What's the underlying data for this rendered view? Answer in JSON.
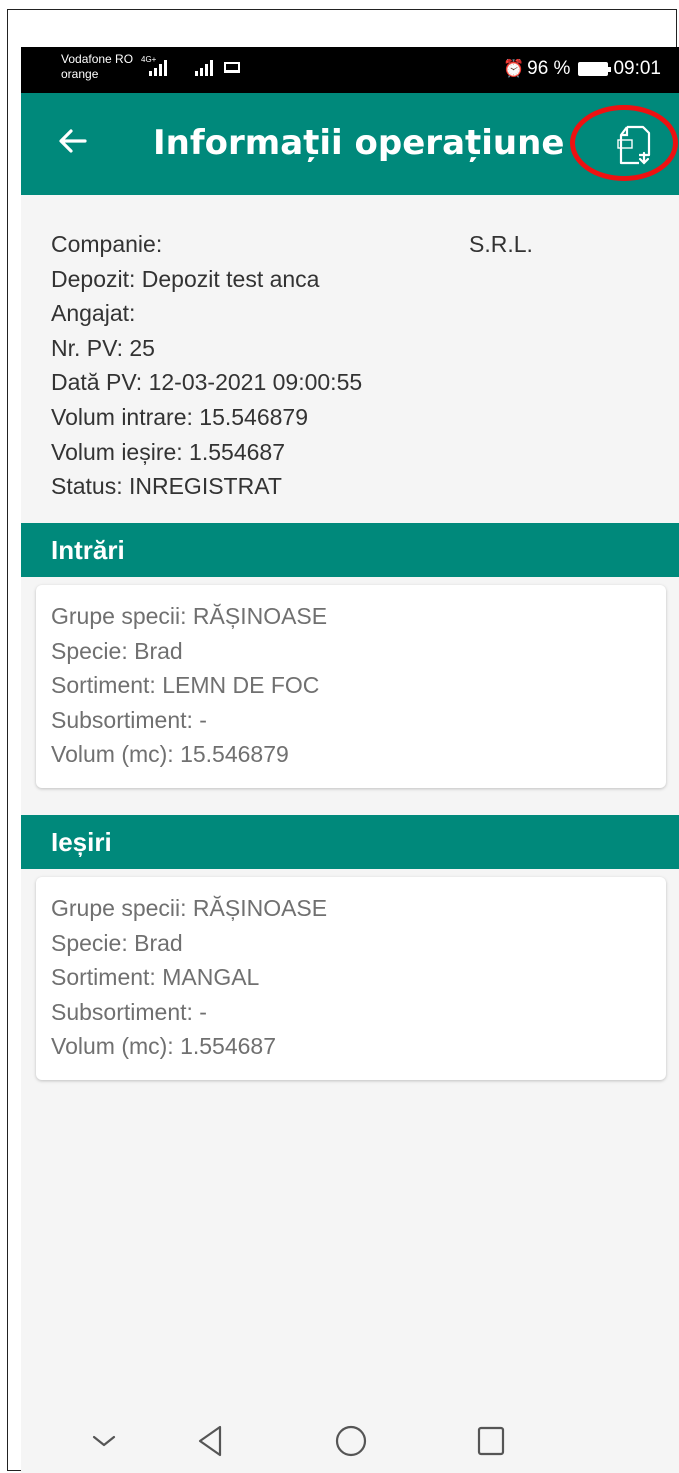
{
  "status_bar": {
    "carrier_1": "Vodafone RO",
    "carrier_2": "orange",
    "network": "4G+",
    "battery": "96 %",
    "time": "09:01"
  },
  "app_bar": {
    "title": "Informații operațiune"
  },
  "info": {
    "company": "Companie:",
    "company_suffix": "S.R.L.",
    "depot": "Depozit: Depozit test anca",
    "employee": "Angajat:",
    "pv_number": "Nr. PV: 25",
    "pv_date": "Dată PV: 12-03-2021 09:00:55",
    "volume_in": "Volum intrare: 15.546879",
    "volume_out": "Volum ieșire: 1.554687",
    "status": "Status: INREGISTRAT"
  },
  "inputs_section": {
    "title": "Intrări",
    "item": {
      "species_group": "Grupe specii: RĂȘINOASE",
      "species": "Specie: Brad",
      "assortment": "Sortiment: LEMN DE FOC",
      "subassortment": "Subsortiment: -",
      "volume": "Volum (mc): 15.546879"
    }
  },
  "outputs_section": {
    "title": "Ieșiri",
    "item": {
      "species_group": "Grupe specii: RĂȘINOASE",
      "species": "Specie: Brad",
      "assortment": "Sortiment: MANGAL",
      "subassortment": "Subsortiment: -",
      "volume": "Volum (mc): 1.554687"
    }
  },
  "colors": {
    "primary": "#00897b",
    "highlight": "#ee1111"
  },
  "icons": [
    "back-arrow-icon",
    "pdf-download-icon",
    "alarm-icon",
    "battery-icon",
    "nav-down-icon",
    "nav-back-icon",
    "nav-home-icon",
    "nav-recents-icon"
  ]
}
